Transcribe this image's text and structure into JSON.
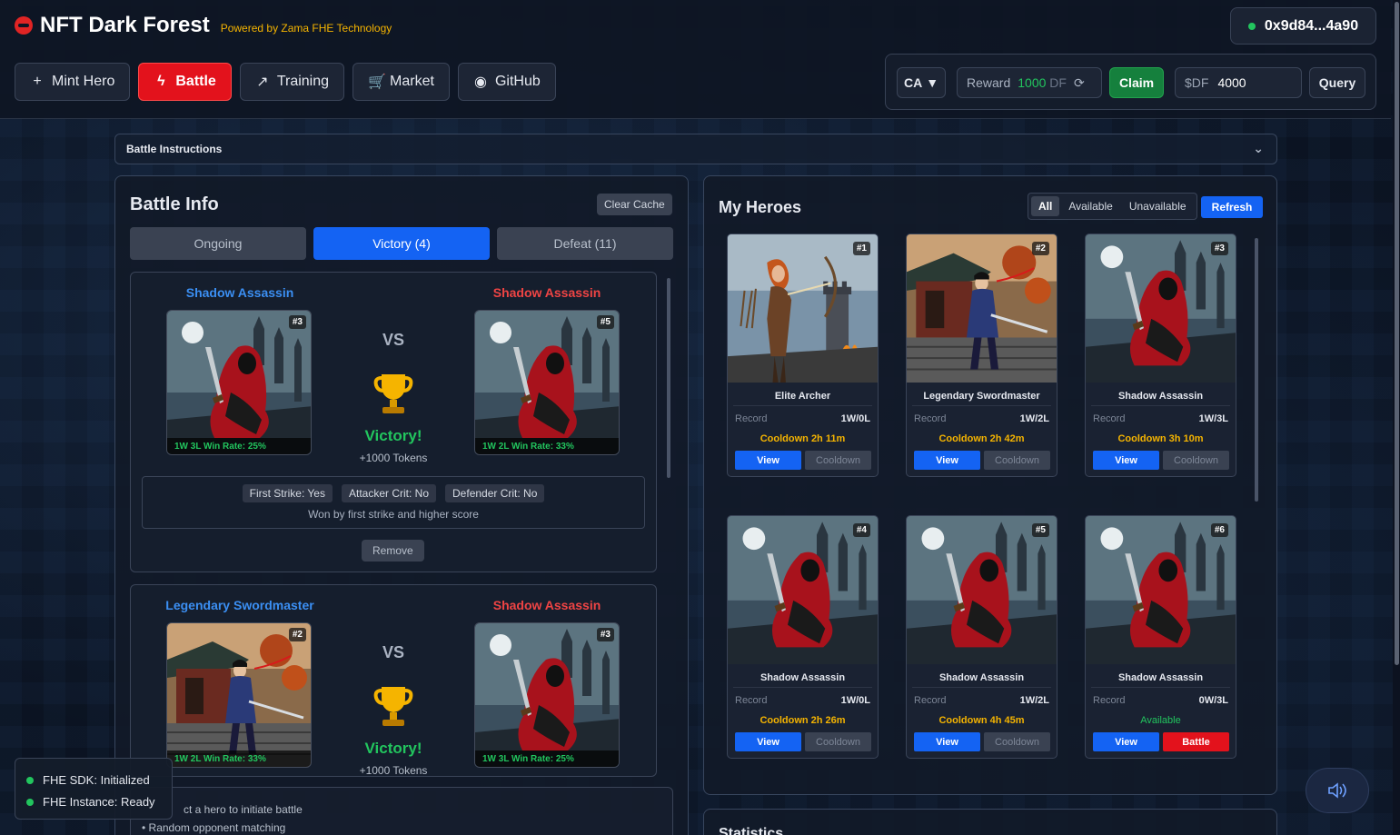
{
  "header": {
    "title": "NFT Dark Forest",
    "subtitle": "Powered by Zama FHE Technology",
    "wallet": "0x9d84...4a90",
    "nav": [
      {
        "label": "Mint Hero",
        "icon": "plus-icon"
      },
      {
        "label": "Battle",
        "icon": "lightning-icon"
      },
      {
        "label": "Training",
        "icon": "trend-icon"
      },
      {
        "label": "Market",
        "icon": "cart-icon"
      },
      {
        "label": "GitHub",
        "icon": "github-icon"
      }
    ],
    "controls": {
      "ca": "CA",
      "reward_label": "Reward",
      "reward_value": "1000",
      "reward_unit": "DF",
      "claim": "Claim",
      "sdf_label": "$DF",
      "sdf_value": "4000",
      "query": "Query"
    }
  },
  "instructions": {
    "label": "Battle Instructions"
  },
  "battle_info": {
    "title": "Battle Info",
    "clear_cache": "Clear Cache",
    "tabs": [
      "Ongoing",
      "Victory (4)",
      "Defeat (11)"
    ],
    "battles": [
      {
        "attacker": {
          "name": "Shadow Assassin",
          "id": "#3",
          "rate": "1W 3L Win Rate: 25%"
        },
        "defender": {
          "name": "Shadow Assassin",
          "id": "#5",
          "rate": "1W 2L Win Rate: 33%"
        },
        "vs": "VS",
        "result": "Victory!",
        "tokens": "+1000 Tokens",
        "chips": [
          "First Strike: Yes",
          "Attacker Crit: No",
          "Defender Crit: No"
        ],
        "won_by": "Won by first strike and higher score",
        "remove": "Remove"
      },
      {
        "attacker": {
          "name": "Legendary Swordmaster",
          "id": "#2",
          "rate": "1W 2L Win Rate: 33%"
        },
        "defender": {
          "name": "Shadow Assassin",
          "id": "#3",
          "rate": "1W 3L Win Rate: 25%"
        },
        "vs": "VS",
        "result": "Victory!",
        "tokens": "+1000 Tokens"
      }
    ],
    "hints": [
      "ct a hero to initiate battle",
      "• Random opponent matching"
    ]
  },
  "my_heroes": {
    "title": "My Heroes",
    "filters": [
      "All",
      "Available",
      "Unavailable"
    ],
    "refresh": "Refresh",
    "record_label": "Record",
    "view": "View",
    "cooldown": "Cooldown",
    "battle": "Battle",
    "heroes": [
      {
        "id": "#1",
        "name": "Elite Archer",
        "record": "1W/0L",
        "status": "Cooldown 2h 11m",
        "art": "archer"
      },
      {
        "id": "#2",
        "name": "Legendary Swordmaster",
        "record": "1W/2L",
        "status": "Cooldown 2h 42m",
        "art": "sword"
      },
      {
        "id": "#3",
        "name": "Shadow Assassin",
        "record": "1W/3L",
        "status": "Cooldown 3h 10m",
        "art": "assassin"
      },
      {
        "id": "#4",
        "name": "Shadow Assassin",
        "record": "1W/0L",
        "status": "Cooldown 2h 26m",
        "art": "assassin"
      },
      {
        "id": "#5",
        "name": "Shadow Assassin",
        "record": "1W/2L",
        "status": "Cooldown 4h 45m",
        "art": "assassin"
      },
      {
        "id": "#6",
        "name": "Shadow Assassin",
        "record": "0W/3L",
        "status": "Available",
        "art": "assassin"
      }
    ]
  },
  "statistics": {
    "title": "Statistics"
  },
  "fhe": {
    "sdk": "FHE SDK: Initialized",
    "instance": "FHE Instance: Ready"
  },
  "colors": {
    "accent_blue": "#1463f3",
    "accent_red": "#e3121c",
    "success": "#22c55e",
    "warning": "#f5b400"
  }
}
